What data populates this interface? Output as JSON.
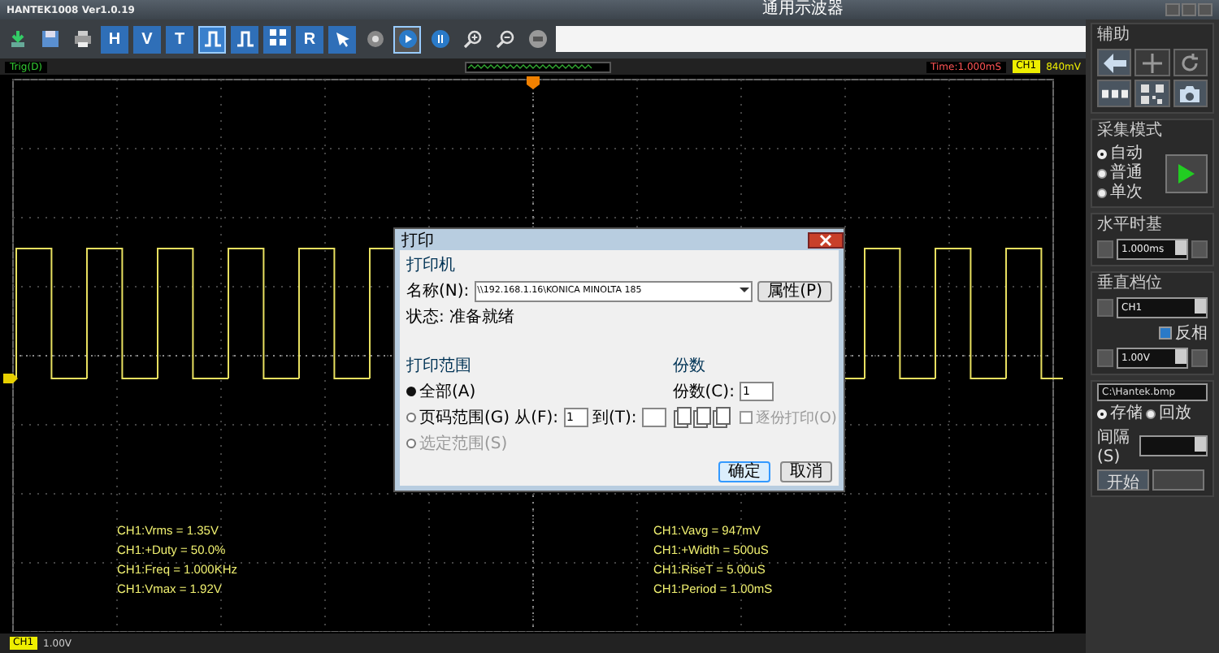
{
  "window": {
    "title": "HANTEK1008 Ver1.0.19",
    "app_name": "通用示波器"
  },
  "toolbar": [
    {
      "kind": "import",
      "selected": false
    },
    {
      "kind": "save",
      "selected": false
    },
    {
      "kind": "print",
      "selected": false
    },
    {
      "kind": "letter",
      "label": "H",
      "selected": false
    },
    {
      "kind": "letter",
      "label": "V",
      "selected": false
    },
    {
      "kind": "letter",
      "label": "T",
      "selected": false
    },
    {
      "kind": "pulse",
      "selected": true
    },
    {
      "kind": "pulse",
      "selected": false
    },
    {
      "kind": "grid",
      "selected": false
    },
    {
      "kind": "letter",
      "label": "R",
      "selected": false
    },
    {
      "kind": "cursor",
      "selected": false
    },
    {
      "kind": "record",
      "selected": false
    },
    {
      "kind": "play",
      "selected": true
    },
    {
      "kind": "pause",
      "selected": false
    },
    {
      "kind": "zoom-in",
      "selected": false
    },
    {
      "kind": "zoom-out",
      "selected": false
    },
    {
      "kind": "zoom-fit",
      "selected": false
    }
  ],
  "status": {
    "trigger": "Trig(D)",
    "time": "Time:1.000mS",
    "channel": "CH1",
    "level": "840mV"
  },
  "measurements_left": [
    "CH1:Vrms = 1.35V",
    "CH1:+Duty = 50.0%",
    "CH1:Freq = 1.000KHz",
    "CH1:Vmax = 1.92V"
  ],
  "measurements_right": [
    "CH1:Vavg = 947mV",
    "CH1:+Width = 500uS",
    "CH1:RiseT = 5.00uS",
    "CH1:Period = 1.00mS"
  ],
  "bottom": {
    "channel": "CH1",
    "scale": "1.00V"
  },
  "panel": {
    "aux_title": "辅助",
    "aux_buttons": [
      {
        "kind": "back",
        "disabled": false
      },
      {
        "kind": "crosshair",
        "disabled": true
      },
      {
        "kind": "rotate",
        "disabled": true
      },
      {
        "kind": "dots",
        "disabled": false
      },
      {
        "kind": "qr",
        "disabled": false
      },
      {
        "kind": "camera",
        "disabled": false
      }
    ],
    "acq_title": "采集模式",
    "acq_modes": [
      {
        "label": "自动",
        "selected": true
      },
      {
        "label": "普通",
        "selected": false
      },
      {
        "label": "单次",
        "selected": false
      }
    ],
    "hor_title": "水平时基",
    "timebase": "1.000ms",
    "ver_title": "垂直档位",
    "channel": "CH1",
    "invert": {
      "label": "反相",
      "checked": true
    },
    "volts": "1.00V",
    "path": "C:\\Hantek.bmp",
    "store_modes": [
      {
        "label": "存储",
        "selected": true
      },
      {
        "label": "回放",
        "selected": false
      }
    ],
    "interval_label": "间隔(S)",
    "start": "开始"
  },
  "dialog": {
    "title": "打印",
    "printer_group": "打印机",
    "name_label": "名称(N):",
    "printer": "\\\\192.168.1.16\\KONICA MINOLTA 185",
    "properties": "属性(P)",
    "status_label": "状态:",
    "status_value": "准备就绪",
    "range_group": "打印范围",
    "ranges": [
      {
        "label": "全部(A)",
        "selected": true,
        "disabled": false
      },
      {
        "label": "页码范围(G)",
        "selected": false,
        "disabled": false
      },
      {
        "label": "选定范围(S)",
        "selected": false,
        "disabled": true
      }
    ],
    "from_label": "从(F):",
    "from_value": "1",
    "to_label": "到(T):",
    "copies_group": "份数",
    "copies_label": "份数(C):",
    "copies_value": "1",
    "collate": {
      "label": "逐份打印(O)",
      "checked": false
    },
    "ok": "确定",
    "cancel": "取消"
  }
}
